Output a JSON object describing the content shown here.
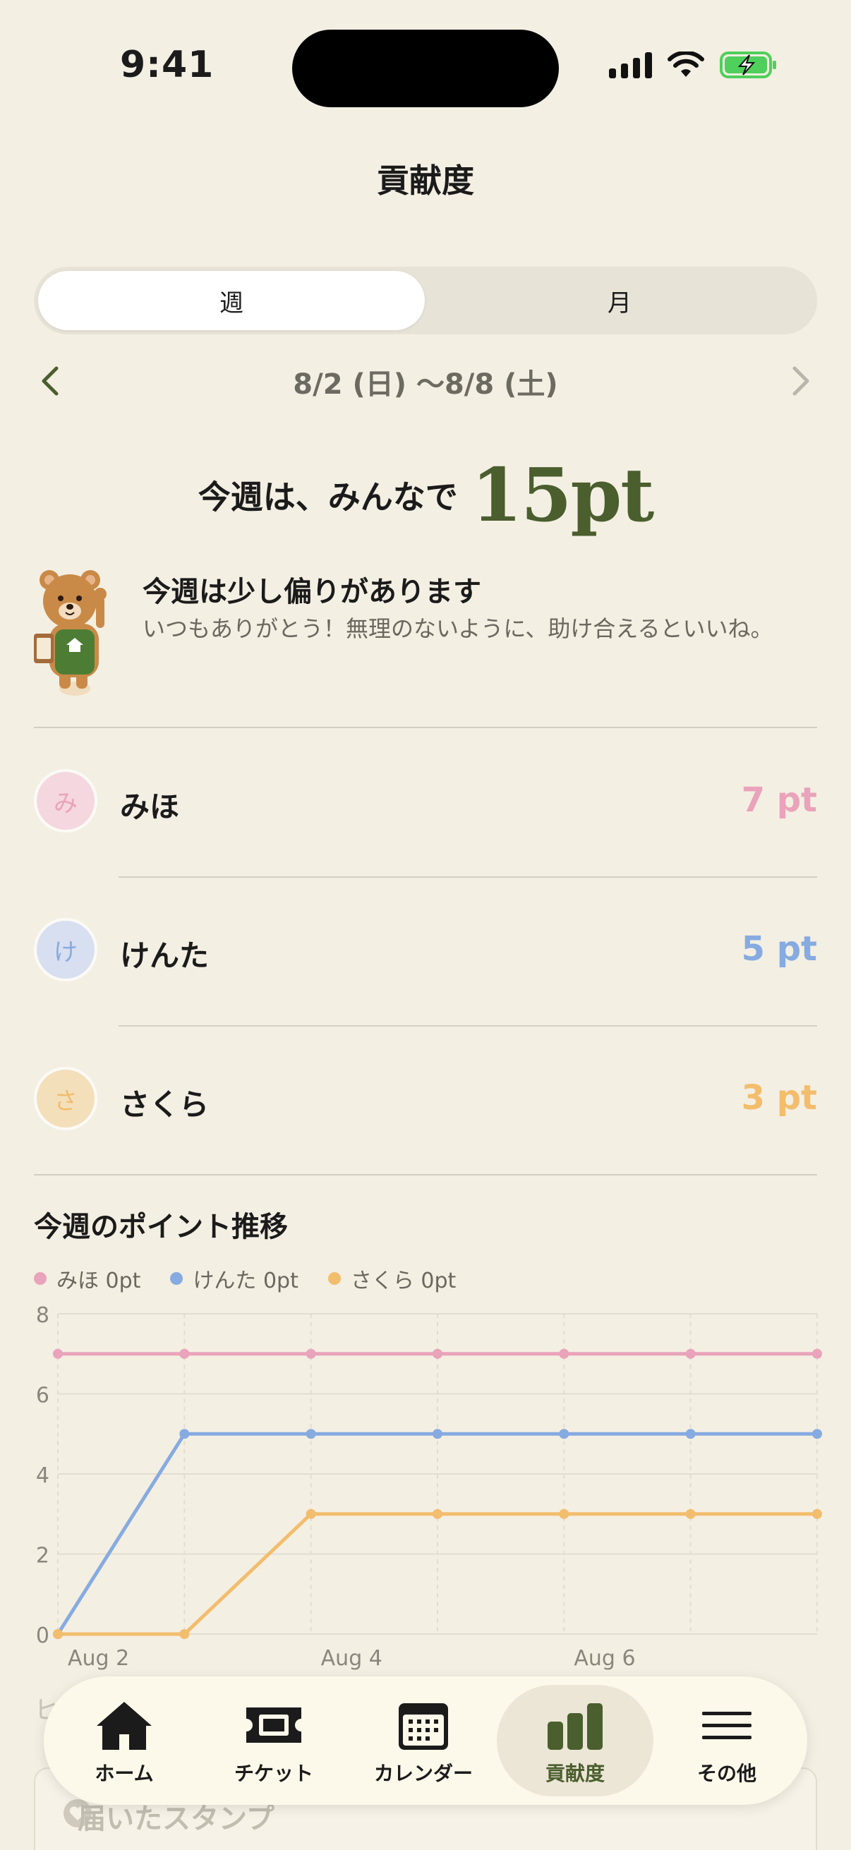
{
  "status": {
    "time": "9:41"
  },
  "header": {
    "title": "貢献度"
  },
  "segmented": {
    "week": "週",
    "month": "月",
    "selected": "週"
  },
  "date_nav": {
    "range": "8/2 (日) 〜8/8 (土)"
  },
  "total": {
    "prefix": "今週は、みんなで",
    "value": "15pt"
  },
  "message": {
    "title": "今週は少し偏りがあります",
    "body": "いつもありがとう！無理のないように、助け合えるといいね。"
  },
  "members": [
    {
      "initial": "み",
      "name": "みほ",
      "points": "7 pt",
      "color": "#e9a3bb",
      "avatar_bg": "#f5d7df"
    },
    {
      "initial": "け",
      "name": "けんた",
      "points": "5 pt",
      "color": "#86abe0",
      "avatar_bg": "#d7dff0"
    },
    {
      "initial": "さ",
      "name": "さくら",
      "points": "3 pt",
      "color": "#f2bd6d",
      "avatar_bg": "#f4dfbb"
    }
  ],
  "chart": {
    "title": "今週のポイント推移",
    "legend": [
      {
        "label": "みほ 0pt",
        "color": "#e9a3bb"
      },
      {
        "label": "けんた 0pt",
        "color": "#86abe0"
      },
      {
        "label": "さくら 0pt",
        "color": "#f2bd6d"
      }
    ]
  },
  "chart_data": {
    "type": "line",
    "x": [
      "Aug 2",
      "Aug 3",
      "Aug 4",
      "Aug 5",
      "Aug 6",
      "Aug 7",
      "Aug 8"
    ],
    "x_tick_labels": [
      "Aug 2",
      "Aug 4",
      "Aug 6"
    ],
    "ylim": [
      0,
      8
    ],
    "y_ticks": [
      0,
      2,
      4,
      6,
      8
    ],
    "grid": true,
    "series": [
      {
        "name": "みほ",
        "color": "#e9a3bb",
        "values": [
          7,
          7,
          7,
          7,
          7,
          7,
          7
        ]
      },
      {
        "name": "けんた",
        "color": "#86abe0",
        "values": [
          0,
          5,
          5,
          5,
          5,
          5,
          5
        ]
      },
      {
        "name": "さくら",
        "color": "#f2bd6d",
        "values": [
          0,
          0,
          3,
          3,
          3,
          3,
          3
        ]
      }
    ]
  },
  "below": {
    "stamp_label": "届いたスタンプ"
  },
  "tabs": [
    {
      "label": "ホーム",
      "icon": "home-icon"
    },
    {
      "label": "チケット",
      "icon": "ticket-icon"
    },
    {
      "label": "カレンダー",
      "icon": "calendar-icon"
    },
    {
      "label": "貢献度",
      "icon": "bar-chart-icon",
      "active": true
    },
    {
      "label": "その他",
      "icon": "menu-icon"
    }
  ]
}
